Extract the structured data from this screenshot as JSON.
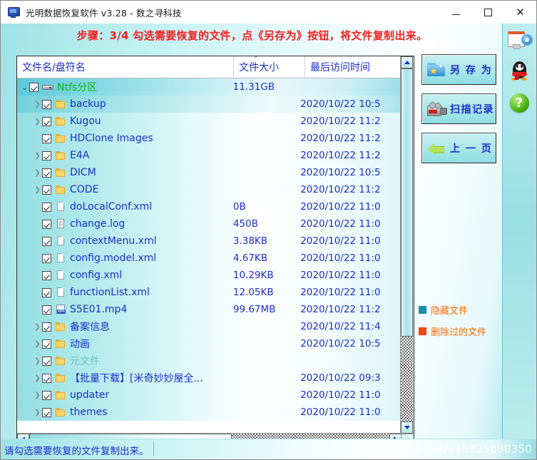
{
  "window": {
    "title": "光明数据恢复软件 v3.28 - 数之寻科技",
    "app_icon": "computer-monitor-icon",
    "minimize_label": "",
    "maximize_label": "",
    "close_label": "✕"
  },
  "step_banner": "步骤：3/4 勾选需要恢复的文件，点《另存为》按钮，将文件复制出来。",
  "columns": {
    "name": "文件名/盘符名",
    "size": "文件大小",
    "time": "最后访问时间",
    "sort_mark": "⌃"
  },
  "rows": [
    {
      "indent": 0,
      "twisty": "open",
      "checked": true,
      "icon": "drive-icon",
      "name": "Ntfs分区",
      "color": "green",
      "size": "11.31GB",
      "time": "",
      "state": "sel"
    },
    {
      "indent": 1,
      "twisty": "closed",
      "checked": true,
      "icon": "folder-icon",
      "name": "backup",
      "color": "blue",
      "size": "",
      "time": "2020/10/22 10:5",
      "state": "sel2"
    },
    {
      "indent": 1,
      "twisty": "closed",
      "checked": true,
      "icon": "folder-icon",
      "name": "Kugou",
      "color": "blue",
      "size": "",
      "time": "2020/10/22 11:2",
      "state": ""
    },
    {
      "indent": 1,
      "twisty": "none",
      "checked": true,
      "icon": "folder-icon",
      "name": "HDClone Images",
      "color": "blue",
      "size": "",
      "time": "2020/10/22 11:2",
      "state": ""
    },
    {
      "indent": 1,
      "twisty": "closed",
      "checked": true,
      "icon": "folder-icon",
      "name": "E4A",
      "color": "blue",
      "size": "",
      "time": "2020/10/22 11:2",
      "state": ""
    },
    {
      "indent": 1,
      "twisty": "closed",
      "checked": true,
      "icon": "folder-icon",
      "name": "DICM",
      "color": "blue",
      "size": "",
      "time": "2020/10/22 10:5",
      "state": ""
    },
    {
      "indent": 1,
      "twisty": "closed",
      "checked": true,
      "icon": "folder-icon",
      "name": "CODE",
      "color": "blue",
      "size": "",
      "time": "2020/10/22 11:2",
      "state": ""
    },
    {
      "indent": 1,
      "twisty": "none",
      "checked": true,
      "icon": "file-icon",
      "name": "doLocalConf.xml",
      "color": "blue",
      "size": "0B",
      "time": "2020/10/22 11:0",
      "state": ""
    },
    {
      "indent": 1,
      "twisty": "none",
      "checked": true,
      "icon": "log-file-icon",
      "name": "change.log",
      "color": "blue",
      "size": "450B",
      "time": "2020/10/22 11:0",
      "state": ""
    },
    {
      "indent": 1,
      "twisty": "none",
      "checked": true,
      "icon": "file-icon",
      "name": "contextMenu.xml",
      "color": "blue",
      "size": "3.38KB",
      "time": "2020/10/22 11:0",
      "state": ""
    },
    {
      "indent": 1,
      "twisty": "none",
      "checked": true,
      "icon": "file-icon",
      "name": "config.model.xml",
      "color": "blue",
      "size": "4.67KB",
      "time": "2020/10/22 11:0",
      "state": ""
    },
    {
      "indent": 1,
      "twisty": "none",
      "checked": true,
      "icon": "file-icon",
      "name": "config.xml",
      "color": "blue",
      "size": "10.29KB",
      "time": "2020/10/22 11:0",
      "state": ""
    },
    {
      "indent": 1,
      "twisty": "none",
      "checked": true,
      "icon": "file-icon",
      "name": "functionList.xml",
      "color": "blue",
      "size": "12.05KB",
      "time": "2020/10/22 11:0",
      "state": ""
    },
    {
      "indent": 1,
      "twisty": "none",
      "checked": true,
      "icon": "mp4-file-icon",
      "name": "S5E01.mp4",
      "color": "blue",
      "size": "99.67MB",
      "time": "2020/10/22 11:2",
      "state": ""
    },
    {
      "indent": 1,
      "twisty": "closed",
      "checked": true,
      "icon": "folder-icon",
      "name": "备案信息",
      "color": "blue",
      "size": "",
      "time": "2020/10/22 11:4",
      "state": ""
    },
    {
      "indent": 1,
      "twisty": "closed",
      "checked": true,
      "icon": "folder-icon",
      "name": "动画",
      "color": "blue",
      "size": "",
      "time": "2020/10/22 10:5",
      "state": ""
    },
    {
      "indent": 1,
      "twisty": "closed",
      "checked": true,
      "icon": "folder-icon",
      "name": "元文件",
      "color": "grey",
      "size": "",
      "time": "",
      "state": ""
    },
    {
      "indent": 1,
      "twisty": "closed",
      "checked": true,
      "icon": "folder-icon",
      "name": "【批量下载】[米奇妙妙屋全...",
      "color": "blue",
      "size": "",
      "time": "2020/10/22 09:3",
      "state": ""
    },
    {
      "indent": 1,
      "twisty": "closed",
      "checked": true,
      "icon": "folder-icon",
      "name": "updater",
      "color": "blue",
      "size": "",
      "time": "2020/10/22 11:0",
      "state": ""
    },
    {
      "indent": 1,
      "twisty": "closed",
      "checked": true,
      "icon": "folder-icon",
      "name": "themes",
      "color": "blue",
      "size": "",
      "time": "2020/10/22 11:0",
      "state": ""
    }
  ],
  "buttons": [
    {
      "label": "另 存 为",
      "icon": "save-as-icon"
    },
    {
      "label": "扫描记录",
      "icon": "video-camera-icon"
    },
    {
      "label": "上 一 页",
      "icon": "back-arrow-icon"
    }
  ],
  "legend": [
    {
      "label": "隐藏文件",
      "color": "#1b8fa8"
    },
    {
      "label": "删除过的文件",
      "color": "#f4460d"
    }
  ],
  "side_icons": [
    {
      "name": "settings-message-icon"
    },
    {
      "name": "qq-penguin-icon"
    },
    {
      "name": "help-question-icon"
    }
  ],
  "status": {
    "text": "请勾选需要恢复的文件复制出来。",
    "watermark": "https://blog.csdn.net/a15825688350"
  },
  "colors": {
    "banner_red": "#f42020",
    "link_blue": "#1b2ecb",
    "drive_green": "#12b312",
    "legend_orange": "#ff6a00"
  }
}
